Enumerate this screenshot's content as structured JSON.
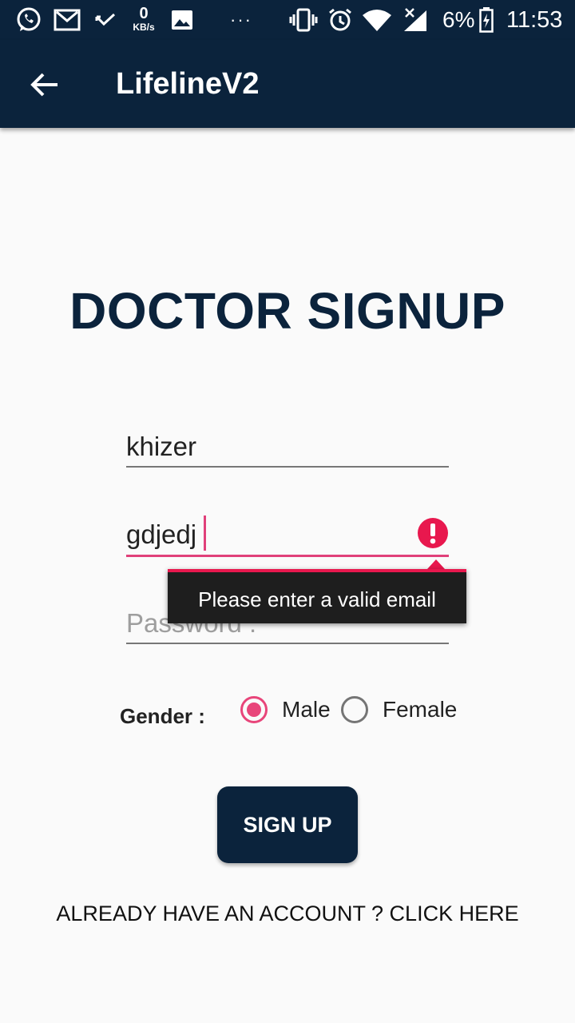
{
  "status_bar": {
    "icons": [
      "whatsapp-icon",
      "gmail-icon",
      "missed-call-icon",
      "image-icon",
      "more-dots-icon",
      "vibrate-icon",
      "alarm-icon",
      "wifi-icon",
      "signal-icon",
      "battery-icon"
    ],
    "data_speed_value": "0",
    "data_speed_unit": "KB/s",
    "more": "···",
    "battery_percent": "6%",
    "time": "11:53"
  },
  "app_bar": {
    "title": "LifelineV2"
  },
  "page": {
    "heading": "DOCTOR SIGNUP"
  },
  "form": {
    "name_value": "khizer",
    "email_value": "gdjedj",
    "email_error": "Please enter a valid email",
    "password_placeholder": "Password :",
    "gender_label": "Gender :",
    "gender_options": [
      "Male",
      "Female"
    ],
    "gender_selected": "Male",
    "signup_label": "SIGN UP",
    "login_link": "ALREADY HAVE AN ACCOUNT ? CLICK HERE"
  },
  "colors": {
    "primary": "#0b233c",
    "accent": "#e8457a",
    "error": "#e8184e"
  }
}
